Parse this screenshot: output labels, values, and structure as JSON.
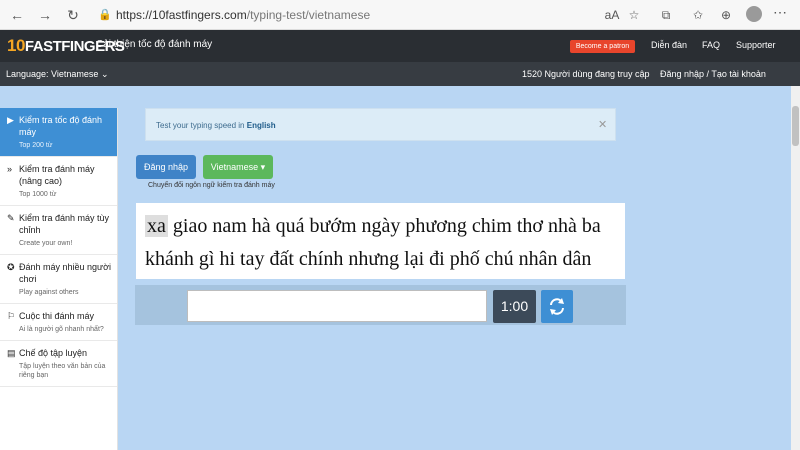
{
  "browser": {
    "url_host": "https://10fastfingers.com",
    "url_path": "/typing-test/vietnamese"
  },
  "header": {
    "logo_ten": "10",
    "logo_text": "FASTFINGERS",
    "tagline": "Cải thiện tốc độ đánh máy",
    "patreon": "Become a patron",
    "nav": [
      "Diễn đàn",
      "FAQ",
      "Supporter"
    ]
  },
  "subheader": {
    "language": "Language: Vietnamese",
    "online": "1520 Người dùng đang truy cập",
    "login": "Đăng nhập / Tạo tài khoản"
  },
  "sidebar": {
    "items": [
      {
        "title": "Kiểm tra tốc độ đánh máy",
        "sub": "Top 200 từ",
        "icon": "▶"
      },
      {
        "title": "Kiểm tra đánh máy (nâng cao)",
        "sub": "Top 1000 từ",
        "icon": "»"
      },
      {
        "title": "Kiểm tra đánh máy tùy chỉnh",
        "sub": "Create your own!",
        "icon": "✎"
      },
      {
        "title": "Đánh máy nhiều người chơi",
        "sub": "Play against others",
        "icon": "✪"
      },
      {
        "title": "Cuộc thi đánh máy",
        "sub": "Ai là người gõ nhanh nhất?",
        "icon": "⚐"
      },
      {
        "title": "Chế độ tập luyện",
        "sub": "Tập luyện theo văn bản của riêng bạn",
        "icon": "▤"
      }
    ]
  },
  "main": {
    "info": "Test your typing speed in",
    "info_lang": "English",
    "btn_login": "Đăng nhập",
    "btn_lang": "Vietnamese ▾",
    "switch_note": "Chuyển đổi ngôn ngữ kiểm tra đánh máy",
    "line1": [
      "xa",
      "giao",
      "nam",
      "hà",
      "quá",
      "bướm",
      "ngày",
      "phương",
      "chim",
      "thơ",
      "nhà",
      "ba"
    ],
    "line2": [
      "khánh",
      "gì",
      "hi",
      "tay",
      "đất",
      "chính",
      "nhưng",
      "lại",
      "đi",
      "phố",
      "chú",
      "nhân",
      "dân"
    ],
    "input_value": "",
    "timer": "1:00"
  }
}
